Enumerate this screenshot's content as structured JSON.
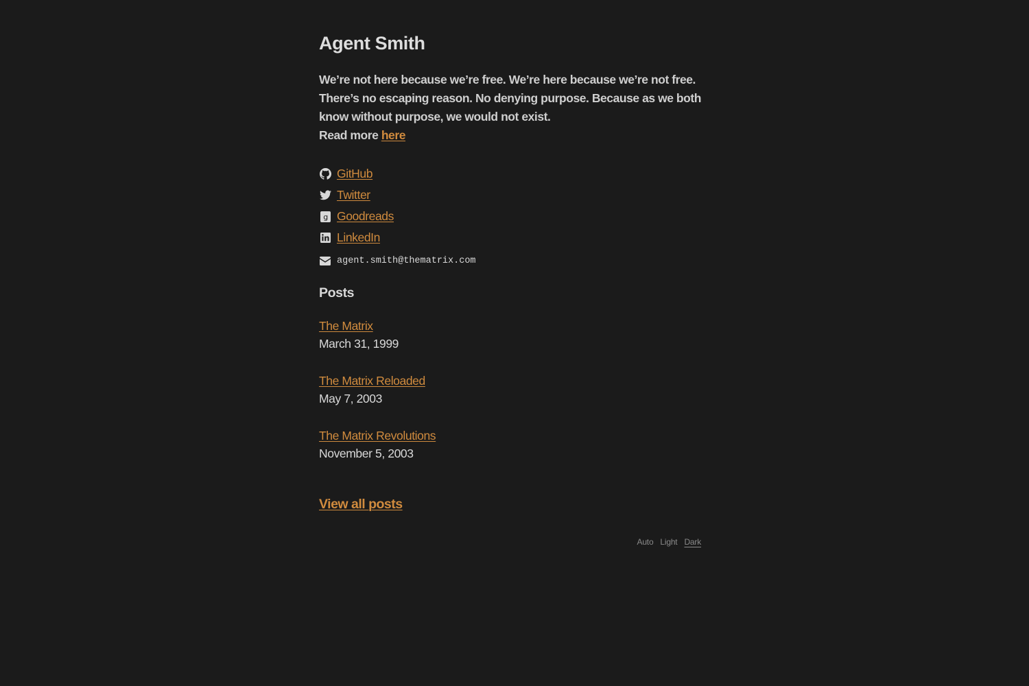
{
  "site": {
    "title": "Agent Smith",
    "bio": "We’re not here because we’re free. We’re here because we’re not free. There’s no escaping reason. No denying purpose. Because as we both know without purpose, we would not exist.",
    "read_more_prefix": "Read more ",
    "read_more_link": "here"
  },
  "social": [
    {
      "label": "GitHub",
      "icon": "github-icon"
    },
    {
      "label": "Twitter",
      "icon": "twitter-icon"
    },
    {
      "label": "Goodreads",
      "icon": "goodreads-icon"
    },
    {
      "label": "LinkedIn",
      "icon": "linkedin-icon"
    }
  ],
  "email": {
    "icon": "envelope-icon",
    "address": "agent.smith@thematrix.com"
  },
  "posts": {
    "heading": "Posts",
    "items": [
      {
        "title": "The Matrix",
        "date": "March 31, 1999"
      },
      {
        "title": "The Matrix Reloaded",
        "date": "May 7, 2003"
      },
      {
        "title": "The Matrix Revolutions",
        "date": "November 5, 2003"
      }
    ],
    "view_all": "View all posts"
  },
  "theme": {
    "options": [
      "Auto",
      "Light",
      "Dark"
    ],
    "selected": "Dark"
  },
  "colors": {
    "background": "#1b1b1b",
    "link": "#d08b3e",
    "text": "#d8d8d8",
    "muted": "#8a8a8a"
  }
}
